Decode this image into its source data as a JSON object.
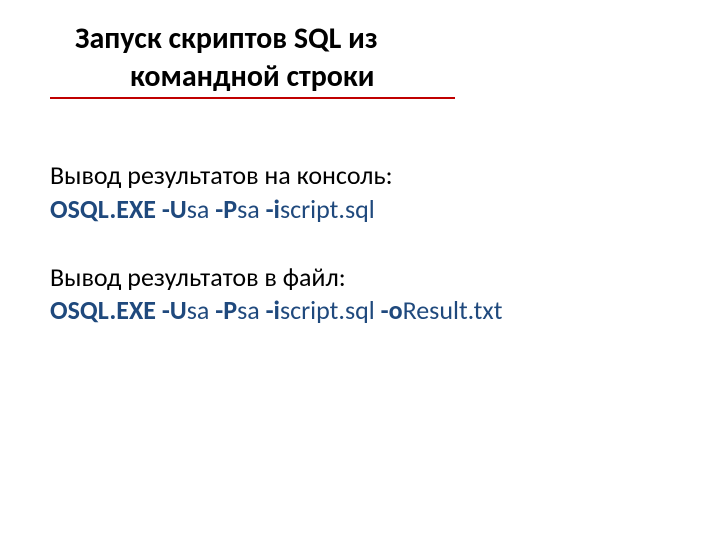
{
  "title_line1": "Запуск скриптов SQL из",
  "title_line2": "командной строки",
  "section1": {
    "label": "Вывод результатов на консоль:",
    "exe": "OSQL.EXE -U",
    "u_val": "sa",
    "p_flag": " -P",
    "p_val": "sa",
    "i_flag": " -i",
    "i_val": "script.sql"
  },
  "section2": {
    "label": "Вывод результатов в файл:",
    "exe": "OSQL.EXE -U",
    "u_val": "sa",
    "p_flag": " -P",
    "p_val": "sa",
    "i_flag": " -i",
    "i_val": "script.sql",
    "o_flag": " -o",
    "o_val": "Result.txt"
  }
}
